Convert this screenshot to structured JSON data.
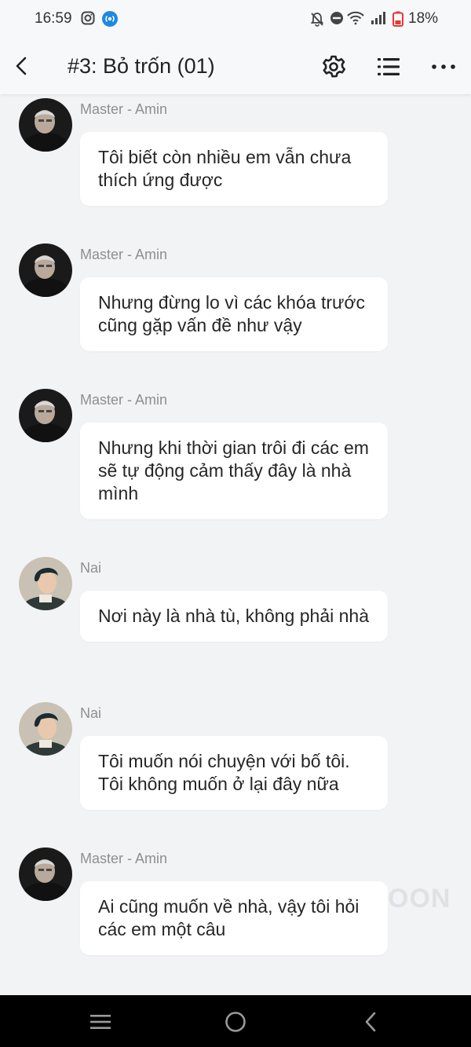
{
  "status_bar": {
    "time": "16:59",
    "battery": "18%"
  },
  "header": {
    "title": "#3: Bỏ trốn (01)"
  },
  "messages": [
    {
      "sender": "Master - Amin",
      "text": "Tôi biết còn nhiều em vẫn chưa thích ứng được",
      "avatar": "elder"
    },
    {
      "sender": "Master - Amin",
      "text": "Nhưng đừng lo vì các khóa trước cũng gặp vấn đề như vậy",
      "avatar": "elder"
    },
    {
      "sender": "Master - Amin",
      "text": "Nhưng khi thời gian trôi đi các em sẽ tự động cảm thấy đây là nhà mình",
      "avatar": "elder"
    },
    {
      "sender": "Nai",
      "text": "Nơi này là nhà tù, không phải nhà",
      "avatar": "young"
    },
    {
      "sender": "Nai",
      "text": "Tôi muốn nói chuyện với bố tôi. Tôi không muốn ở lại đây nữa",
      "avatar": "young"
    },
    {
      "sender": "Master - Amin",
      "text": "Ai cũng muốn về nhà, vậy tôi hỏi các em một câu",
      "avatar": "elder"
    }
  ],
  "watermark": "OON",
  "colors": {
    "background": "#f2f3f5",
    "bubble": "#ffffff",
    "sender_text": "#8d8f94",
    "nav_bar": "#000000"
  }
}
